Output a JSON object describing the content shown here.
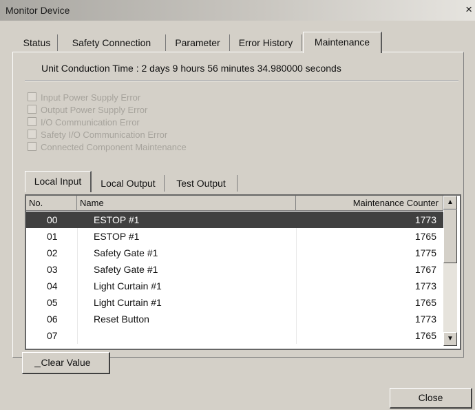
{
  "window": {
    "title": "Monitor Device",
    "close_glyph": "×"
  },
  "tabs": [
    {
      "label": "Status"
    },
    {
      "label": "Safety Connection"
    },
    {
      "label": "Parameter"
    },
    {
      "label": "Error History"
    },
    {
      "label": "Maintenance"
    }
  ],
  "active_tab": "Maintenance",
  "unit_conduction_time": "Unit Conduction Time :  2 days 9 hours 56 minutes 34.980000 seconds",
  "checkboxes": [
    {
      "label": "Input Power Supply Error",
      "checked": false,
      "enabled": false
    },
    {
      "label": "Output Power Supply Error",
      "checked": false,
      "enabled": false
    },
    {
      "label": "I/O Communication Error",
      "checked": false,
      "enabled": false
    },
    {
      "label": "Safety I/O Communication Error",
      "checked": false,
      "enabled": false
    },
    {
      "label": "Connected Component Maintenance",
      "checked": false,
      "enabled": false
    }
  ],
  "subtabs": [
    {
      "label": "Local Input"
    },
    {
      "label": "Local Output"
    },
    {
      "label": "Test Output"
    }
  ],
  "active_subtab": "Local Input",
  "table": {
    "columns": [
      "No.",
      "Name",
      "Maintenance Counter"
    ],
    "rows": [
      {
        "no": "00",
        "name": "ESTOP #1",
        "counter": "1773",
        "selected": true
      },
      {
        "no": "01",
        "name": "ESTOP #1",
        "counter": "1765"
      },
      {
        "no": "02",
        "name": "Safety Gate #1",
        "counter": "1775"
      },
      {
        "no": "03",
        "name": "Safety Gate #1",
        "counter": "1767"
      },
      {
        "no": "04",
        "name": "Light Curtain #1",
        "counter": "1773"
      },
      {
        "no": "05",
        "name": "Light Curtain #1",
        "counter": "1765"
      },
      {
        "no": "06",
        "name": "Reset Button",
        "counter": "1773"
      },
      {
        "no": "07",
        "name": "",
        "counter": "1765"
      }
    ]
  },
  "buttons": {
    "clear": "Clear Value",
    "close": "Close"
  },
  "icons": {
    "scroll_up": "▲",
    "scroll_down": "▼"
  },
  "colors": {
    "face": "#d4d0c8",
    "selection": "#404040",
    "disabled_text": "#a6a39c"
  }
}
